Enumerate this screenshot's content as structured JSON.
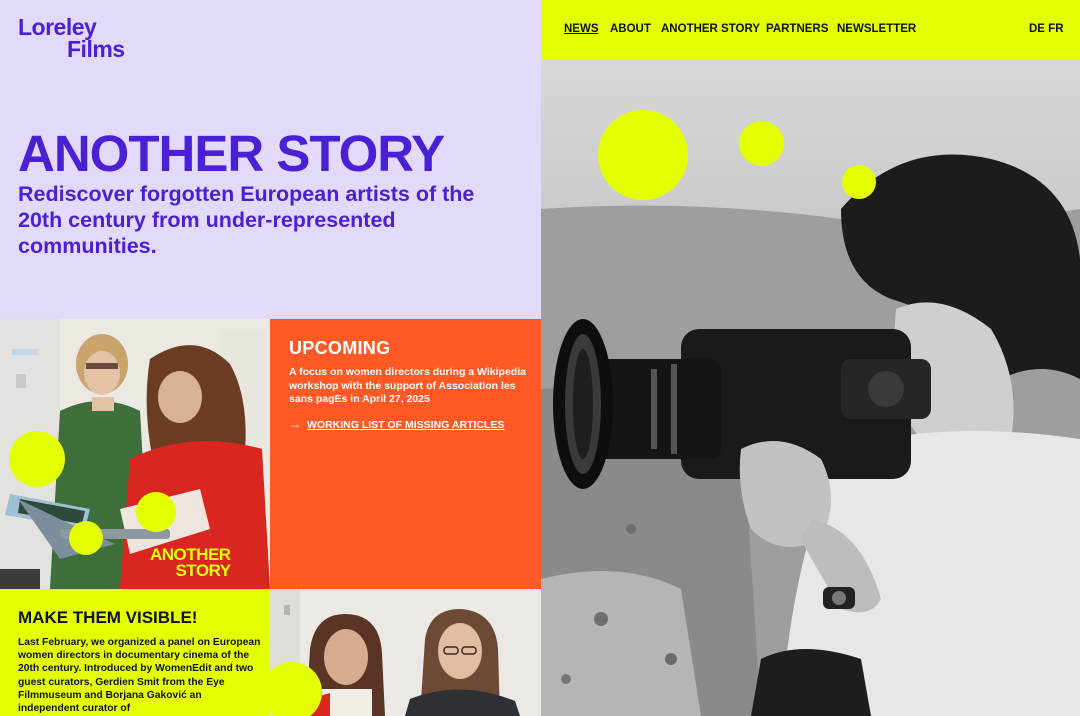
{
  "brand": {
    "line1": "Loreley",
    "line2": "Films"
  },
  "colors": {
    "lavender": "#e2d9fb",
    "violet": "#4a1fd6",
    "lime": "#e3ff00",
    "orange": "#ff5a26"
  },
  "nav": {
    "items": [
      {
        "label": "NEWS",
        "active": true
      },
      {
        "label": "ABOUT",
        "active": false
      },
      {
        "label": "ANOTHER STORY",
        "active": false
      },
      {
        "label": "PARTNERS",
        "active": false
      },
      {
        "label": "NEWSLETTER",
        "active": false
      }
    ],
    "lang": "DE FR"
  },
  "hero": {
    "title": "ANOTHER STORY",
    "subtitle": "Rediscover forgotten European artists of the 20th century from under-represented communities."
  },
  "upcoming": {
    "title": "UPCOMING",
    "text": "A focus on women directors during a Wikipedia workshop with the support of Association les sans pagEs in April 27, 2025",
    "link_arrow": "→",
    "link": "WORKING LIST OF MISSING ARTICLES"
  },
  "stamp": {
    "line1": "ANOTHER",
    "line2": "STORY"
  },
  "visible": {
    "title": "MAKE THEM VISIBLE!",
    "text": "Last February, we organized a panel on European women directors in documentary cinema of the 20th century. Introduced by WomenEdit and two guest curators, Gerdien Smit from the Eye Filmmuseum and Borjana Gaković an independent curator of"
  },
  "images": {
    "photo1": "photo-two-women-laptop",
    "photo2": "photo-two-women-smiling",
    "photo3": "photo-woman-film-camera"
  }
}
